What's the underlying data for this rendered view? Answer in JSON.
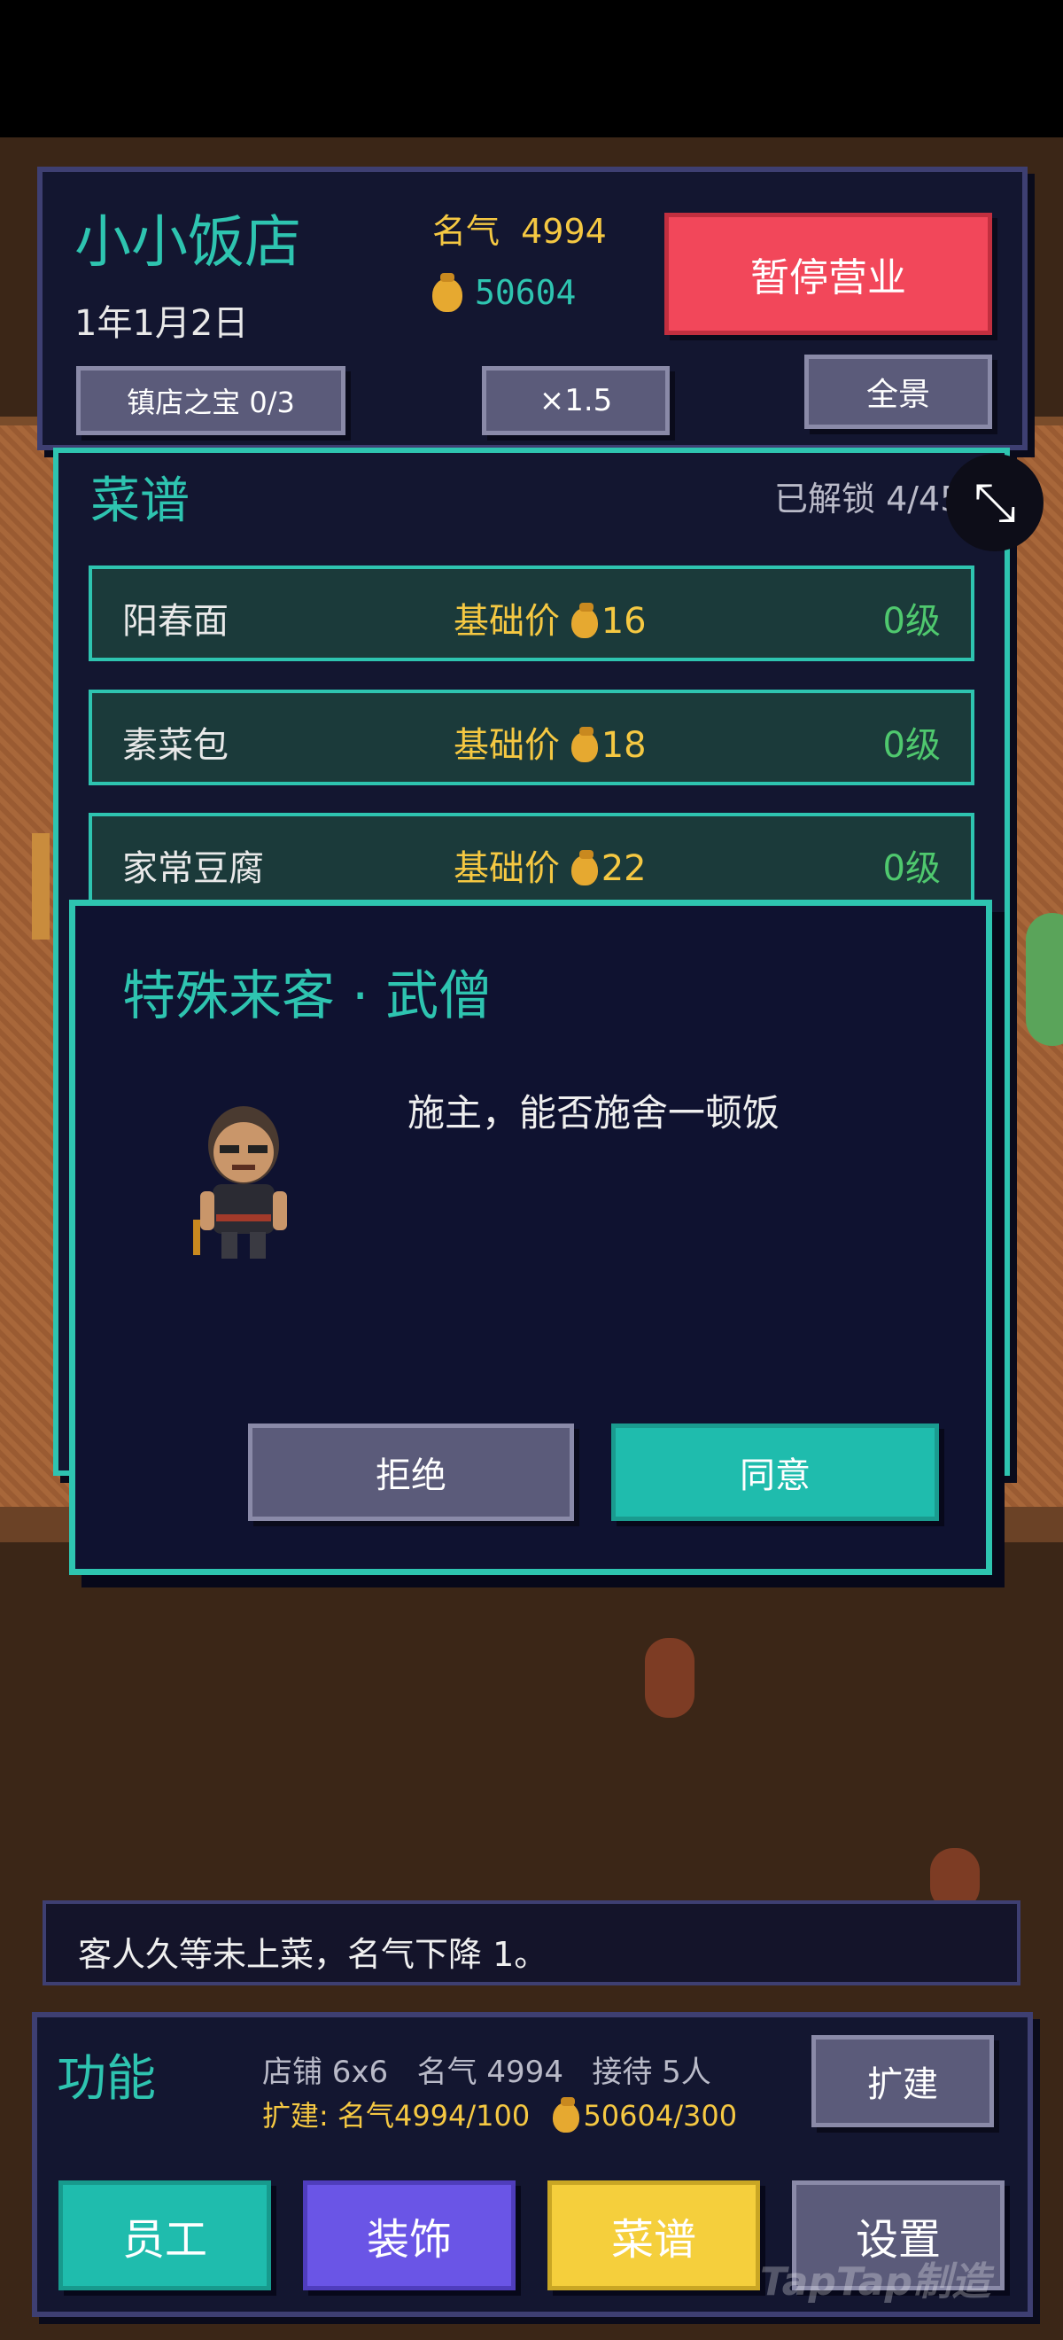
{
  "header": {
    "shop_name": "小小饭店",
    "date": "1年1月2日",
    "fame_label": "名气",
    "fame_value": "4994",
    "coins": "50604",
    "pause_label": "暂停营业",
    "treasure_label": "镇店之宝 0/3",
    "speed_label": "×1.5",
    "panorama_label": "全景"
  },
  "recipes": {
    "title": "菜谱",
    "unlocked_label": "已解锁 4/45",
    "items": [
      {
        "name": "阳春面",
        "price_label": "基础价",
        "price": "16",
        "level": "0级"
      },
      {
        "name": "素菜包",
        "price_label": "基础价",
        "price": "18",
        "level": "0级"
      },
      {
        "name": "家常豆腐",
        "price_label": "基础价",
        "price": "22",
        "level": "0级"
      }
    ]
  },
  "dialog": {
    "title": "特殊来客 · 武僧",
    "speech": "施主，能否施舍一顿饭",
    "refuse_label": "拒绝",
    "agree_label": "同意"
  },
  "log": {
    "message": "客人久等未上菜，名气下降 1。"
  },
  "functions": {
    "title": "功能",
    "stats": "店铺 6x6   名气 4994   接待 5人",
    "expand_req_prefix": "扩建: 名气4994/100",
    "expand_req_coins": "50604/300",
    "expand_label": "扩建",
    "staff_label": "员工",
    "decor_label": "装饰",
    "menu_label": "菜谱",
    "settings_label": "设置"
  },
  "watermark": "TapTap制造",
  "colors": {
    "accent": "#2ec4b0",
    "gold": "#f5c842",
    "danger": "#f2475a",
    "panel": "#131630",
    "level_green": "#4fc86e"
  }
}
